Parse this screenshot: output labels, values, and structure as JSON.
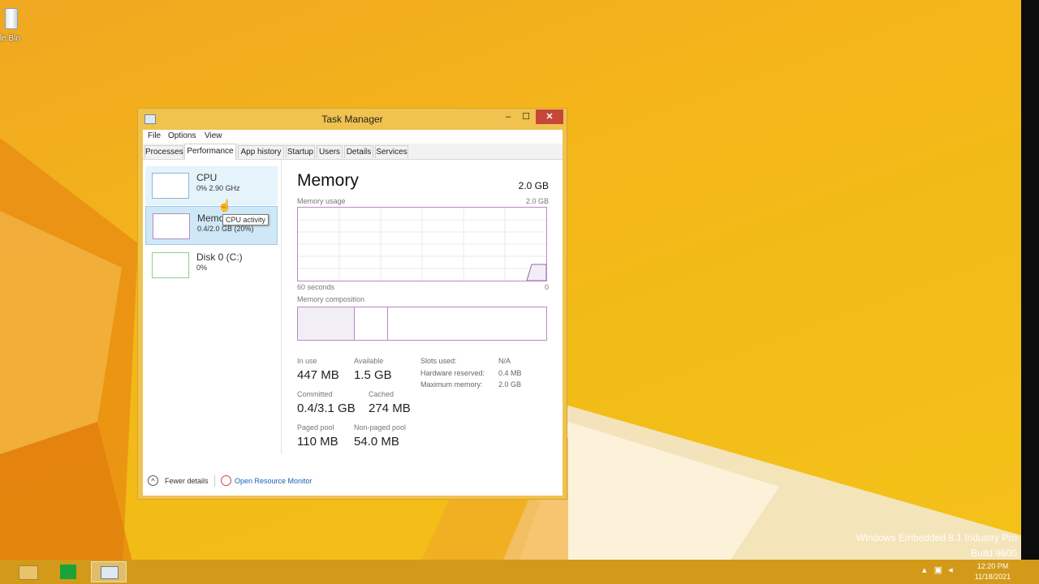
{
  "desktop": {
    "recycle_bin_label": "le Bin",
    "watermark_line1": "Windows Embedded 8.1 Industry Pro",
    "watermark_line2": "Build 9600"
  },
  "window": {
    "title": "Task Manager",
    "controls": {
      "minimize": "–",
      "maximize": "☐",
      "close": "✕"
    },
    "menu": [
      "File",
      "Options",
      "View"
    ],
    "tabs": [
      "Processes",
      "Performance",
      "App history",
      "Startup",
      "Users",
      "Details",
      "Services"
    ],
    "active_tab": "Performance"
  },
  "sidebar": {
    "items": [
      {
        "name": "CPU",
        "sub": "0% 2.90 GHz",
        "state": "hover"
      },
      {
        "name": "Memory",
        "sub": "0.4/2.0 GB (20%)",
        "state": "selected"
      },
      {
        "name": "Disk 0 (C:)",
        "sub": "0%",
        "state": "normal"
      }
    ],
    "tooltip": "CPU activity"
  },
  "memory": {
    "title": "Memory",
    "total": "2.0 GB",
    "usage_label": "Memory usage",
    "usage_max": "2.0 GB",
    "axis_left": "60 seconds",
    "axis_right": "0",
    "composition_label": "Memory composition",
    "stats": {
      "in_use_label": "In use",
      "in_use": "447 MB",
      "available_label": "Available",
      "available": "1.5 GB",
      "committed_label": "Committed",
      "committed": "0.4/3.1 GB",
      "cached_label": "Cached",
      "cached": "274 MB",
      "paged_label": "Paged pool",
      "paged": "110 MB",
      "nonpaged_label": "Non-paged pool",
      "nonpaged": "54.0 MB"
    },
    "details": {
      "slots_label": "Slots used:",
      "slots": "N/A",
      "hw_label": "Hardware reserved:",
      "hw": "0.4 MB",
      "max_label": "Maximum memory:",
      "max": "2.0 GB"
    }
  },
  "footer": {
    "fewer_details": "Fewer details",
    "open_resource_monitor": "Open Resource Monitor"
  },
  "taskbar": {
    "time": "12:20 PM",
    "date": "11/18/2021"
  }
}
